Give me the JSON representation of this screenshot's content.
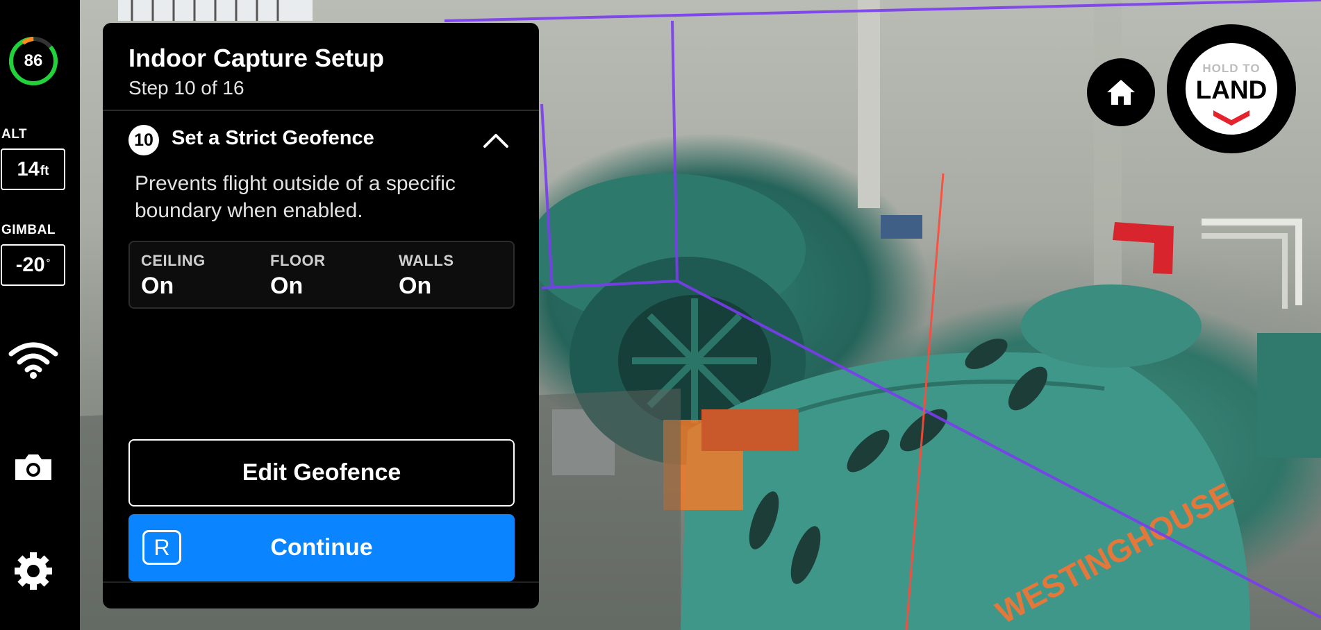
{
  "status": {
    "battery_percent": 86,
    "battery_label": "86",
    "altitude_label": "ALT",
    "altitude_value": "14",
    "altitude_unit": "ft",
    "gimbal_label": "GIMBAL",
    "gimbal_value": "-20",
    "gimbal_unit": "°"
  },
  "sidebar": {
    "icons": [
      "wifi-icon",
      "camera-icon",
      "gear-icon"
    ]
  },
  "panel": {
    "title": "Indoor Capture Setup",
    "step": "Step 10 of 16",
    "step_number": "10",
    "step_title": "Set a Strict Geofence",
    "description": "Prevents flight outside of a specific boundary when enabled.",
    "geofence": [
      {
        "label": "CEILING",
        "value": "On"
      },
      {
        "label": "FLOOR",
        "value": "On"
      },
      {
        "label": "WALLS",
        "value": "On"
      }
    ],
    "edit_button": "Edit Geofence",
    "continue_button": "Continue",
    "continue_key": "R"
  },
  "controls": {
    "home_icon": "home-icon",
    "land_small": "HOLD TO",
    "land_big": "LAND"
  },
  "colors": {
    "accent_blue": "#0a84ff",
    "battery_green": "#22d23a",
    "battery_orange": "#ff8a1f",
    "land_red": "#e5232c",
    "geofence_purple": "#7b3cf0",
    "laser_red": "#ff4a3a"
  },
  "feed": {
    "machine_text": "WESTINGHOUSE"
  }
}
